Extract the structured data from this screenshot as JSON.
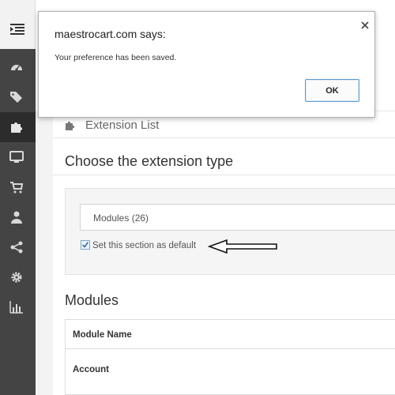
{
  "sidebar": {
    "items": [
      {
        "icon": "dashboard-icon"
      },
      {
        "icon": "tags-icon"
      },
      {
        "icon": "puzzle-icon",
        "active": true
      },
      {
        "icon": "monitor-icon"
      },
      {
        "icon": "cart-icon"
      },
      {
        "icon": "user-icon"
      },
      {
        "icon": "share-icon"
      },
      {
        "icon": "gear-icon"
      },
      {
        "icon": "bar-chart-icon"
      }
    ]
  },
  "extension_list": {
    "title": "Extension List"
  },
  "choose": {
    "title": "Choose the extension type",
    "selected_type": "Modules (26)",
    "default_label": "Set this section as default",
    "default_checked": true
  },
  "modules": {
    "title": "Modules",
    "column_header": "Module Name",
    "rows": [
      "Account"
    ]
  },
  "dialog": {
    "title": "maestrocart.com says:",
    "message": "Your preference has been saved.",
    "ok_label": "OK"
  },
  "colors": {
    "sidebar_bg": "#444444",
    "sidebar_active": "#2c2c2c",
    "button_border": "#5b9bd5"
  }
}
